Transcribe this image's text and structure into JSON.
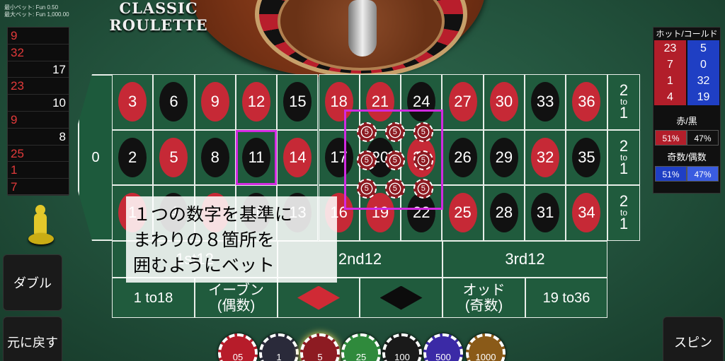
{
  "limits": {
    "min_bet": "最小ベット: Fun 0.50",
    "max_bet": "最大ベット: Fun 1,000.00"
  },
  "title": {
    "line1": "CLASSIC",
    "line2": "ROULETTE"
  },
  "history": [
    {
      "value": "9",
      "color": "red"
    },
    {
      "value": "32",
      "color": "red"
    },
    {
      "value": "17",
      "color": "black"
    },
    {
      "value": "23",
      "color": "red"
    },
    {
      "value": "10",
      "color": "black"
    },
    {
      "value": "9",
      "color": "red"
    },
    {
      "value": "8",
      "color": "black"
    },
    {
      "value": "25",
      "color": "red"
    },
    {
      "value": "1",
      "color": "red"
    },
    {
      "value": "7",
      "color": "red"
    }
  ],
  "buttons": {
    "double": "ダブル",
    "undo": "元に戻す",
    "spin": "スピン"
  },
  "hot_cold": {
    "title": "ホット/コールド",
    "hot": [
      "23",
      "7",
      "1",
      "4"
    ],
    "cold": [
      "5",
      "0",
      "32",
      "19"
    ],
    "red_black_label": "赤/黒",
    "red_pct": "51%",
    "black_pct": "47%",
    "odd_even_label": "奇数/偶数",
    "odd_pct": "51%",
    "even_pct": "47%"
  },
  "table": {
    "zero": "0",
    "rows": [
      [
        {
          "n": "3",
          "c": "red"
        },
        {
          "n": "6",
          "c": "black"
        },
        {
          "n": "9",
          "c": "red"
        },
        {
          "n": "12",
          "c": "red"
        },
        {
          "n": "15",
          "c": "black"
        },
        {
          "n": "18",
          "c": "red"
        },
        {
          "n": "21",
          "c": "red"
        },
        {
          "n": "24",
          "c": "black"
        },
        {
          "n": "27",
          "c": "red"
        },
        {
          "n": "30",
          "c": "red"
        },
        {
          "n": "33",
          "c": "black"
        },
        {
          "n": "36",
          "c": "red"
        }
      ],
      [
        {
          "n": "2",
          "c": "black"
        },
        {
          "n": "5",
          "c": "red"
        },
        {
          "n": "8",
          "c": "black"
        },
        {
          "n": "11",
          "c": "black"
        },
        {
          "n": "14",
          "c": "red"
        },
        {
          "n": "17",
          "c": "black"
        },
        {
          "n": "20",
          "c": "black"
        },
        {
          "n": "23",
          "c": "red"
        },
        {
          "n": "26",
          "c": "black"
        },
        {
          "n": "29",
          "c": "black"
        },
        {
          "n": "32",
          "c": "red"
        },
        {
          "n": "35",
          "c": "black"
        }
      ],
      [
        {
          "n": "1",
          "c": "red"
        },
        {
          "n": "4",
          "c": "black"
        },
        {
          "n": "7",
          "c": "red"
        },
        {
          "n": "10",
          "c": "black"
        },
        {
          "n": "13",
          "c": "black"
        },
        {
          "n": "16",
          "c": "red"
        },
        {
          "n": "19",
          "c": "red"
        },
        {
          "n": "22",
          "c": "black"
        },
        {
          "n": "25",
          "c": "red"
        },
        {
          "n": "28",
          "c": "black"
        },
        {
          "n": "31",
          "c": "black"
        },
        {
          "n": "34",
          "c": "red"
        }
      ]
    ],
    "column_bet": {
      "top": "2",
      "mid": "to",
      "bottom": "1"
    },
    "dozens": [
      "1st12",
      "2nd12",
      "3rd12"
    ],
    "even_bets": {
      "low": "1 to18",
      "even": [
        "イーブン",
        "(偶数)"
      ],
      "odd": [
        "オッド",
        "(奇数)"
      ],
      "high": "19 to36"
    },
    "bet_chip_value": "5"
  },
  "tip": [
    "１つの数字を基準に",
    "まわりの８箇所を",
    "囲むようにベット"
  ],
  "chips": [
    {
      "label": "05",
      "color": "#b71c2a"
    },
    {
      "label": "1",
      "color": "#2a2a3a"
    },
    {
      "label": "5",
      "color": "#8d1b22"
    },
    {
      "label": "25",
      "color": "#2f8a3c"
    },
    {
      "label": "100",
      "color": "#1a1a1a"
    },
    {
      "label": "500",
      "color": "#3b2aa6"
    },
    {
      "label": "1000",
      "color": "#8a5a18"
    }
  ]
}
